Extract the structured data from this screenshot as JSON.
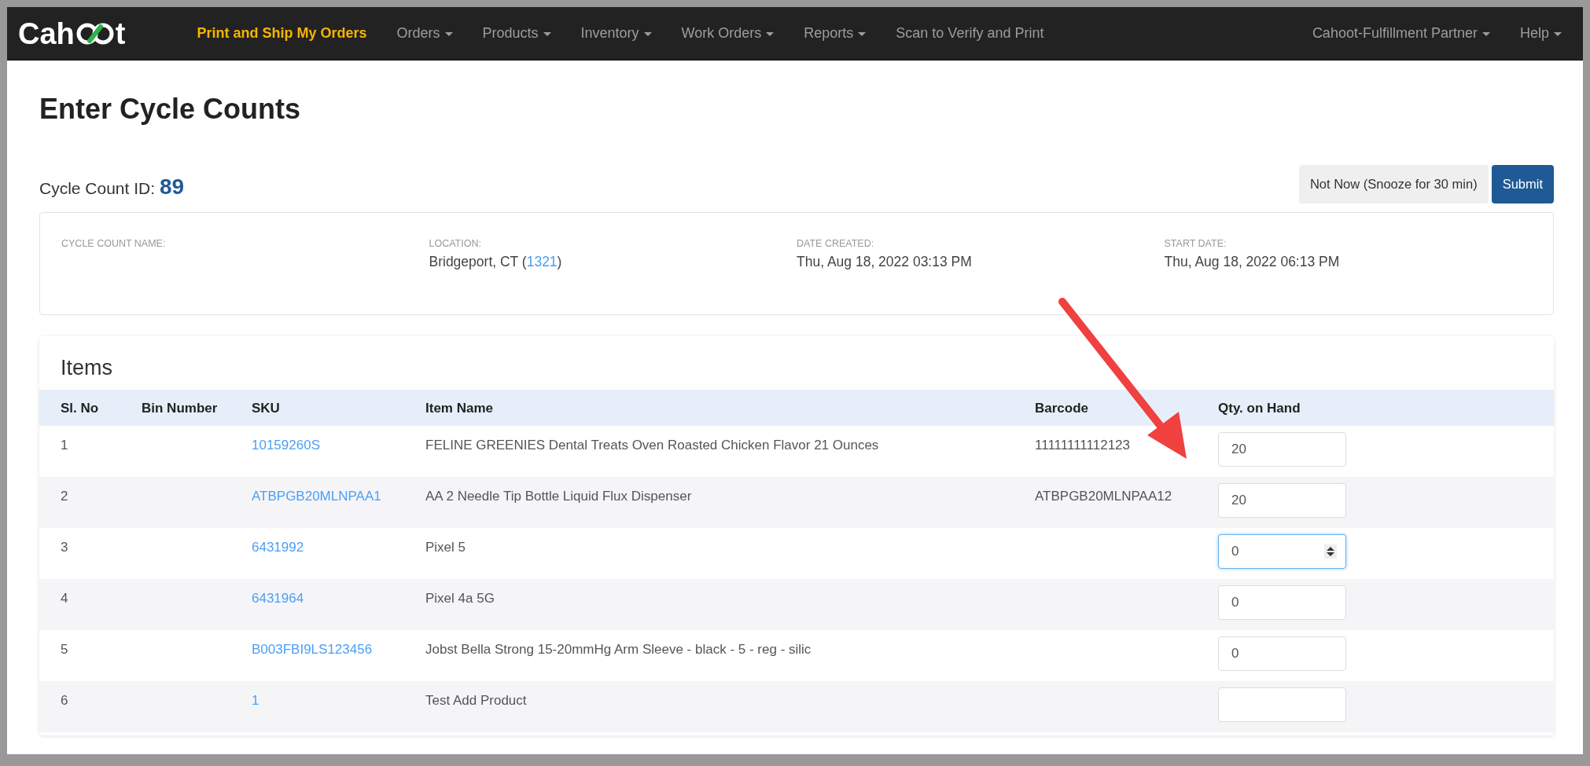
{
  "navbar": {
    "logo_text": [
      "Cah",
      "t"
    ],
    "items": [
      {
        "label": "Print and Ship My Orders",
        "dropdown": false,
        "selected": true
      },
      {
        "label": "Orders",
        "dropdown": true,
        "selected": false
      },
      {
        "label": "Products",
        "dropdown": true,
        "selected": false
      },
      {
        "label": "Inventory",
        "dropdown": true,
        "selected": false
      },
      {
        "label": "Work Orders",
        "dropdown": true,
        "selected": false
      },
      {
        "label": "Reports",
        "dropdown": true,
        "selected": false
      },
      {
        "label": "Scan to Verify and Print",
        "dropdown": false,
        "selected": false
      }
    ],
    "right_items": [
      {
        "label": "Cahoot-Fulfillment Partner",
        "dropdown": true
      },
      {
        "label": "Help",
        "dropdown": true
      }
    ]
  },
  "page_title": "Enter Cycle Counts",
  "cycle_count": {
    "label": "Cycle Count ID:",
    "id": "89"
  },
  "buttons": [
    {
      "label": "Not Now (Snooze for 30 min)",
      "kind": "secondary"
    },
    {
      "label": "Submit",
      "kind": "primary"
    }
  ],
  "info": [
    {
      "label": "CYCLE COUNT NAME:"
    },
    {
      "label": "LOCATION:",
      "value": "Bridgeport, CT (",
      "link": "1321",
      "value_after": ")"
    },
    {
      "label": "DATE CREATED:",
      "value": "Thu, Aug 18, 2022 03:13 PM"
    },
    {
      "label": "START DATE:",
      "value": "Thu, Aug 18, 2022 06:13 PM"
    }
  ],
  "items": {
    "title": "Items",
    "columns": [
      "Sl. No",
      "Bin Number",
      "SKU",
      "Item Name",
      "Barcode",
      "Qty. on Hand"
    ],
    "rows": [
      {
        "sl_no": "1",
        "sku": "10159260S",
        "item_name": "FELINE GREENIES Dental Treats Oven Roasted Chicken Flavor 21 Ounces",
        "barcode": "11111111112123",
        "qty": "20",
        "focused": false
      },
      {
        "sl_no": "2",
        "sku": "ATBPGB20MLNPAA1",
        "item_name": "AA 2 Needle Tip Bottle Liquid Flux Dispenser",
        "barcode": "ATBPGB20MLNPAA12",
        "qty": "20",
        "focused": false
      },
      {
        "sl_no": "3",
        "sku": "6431992",
        "item_name": "Pixel 5",
        "qty": "0",
        "focused": true
      },
      {
        "sl_no": "4",
        "sku": "6431964",
        "item_name": "Pixel 4a 5G",
        "qty": "0",
        "focused": false
      },
      {
        "sl_no": "5",
        "sku": "B003FBI9LS123456",
        "item_name": "Jobst Bella Strong 15-20mmHg Arm Sleeve - black - 5 - reg - silic",
        "qty": "0",
        "focused": false
      },
      {
        "sl_no": "6",
        "sku": "1",
        "item_name": "Test Add Product",
        "focused": false
      }
    ]
  }
}
